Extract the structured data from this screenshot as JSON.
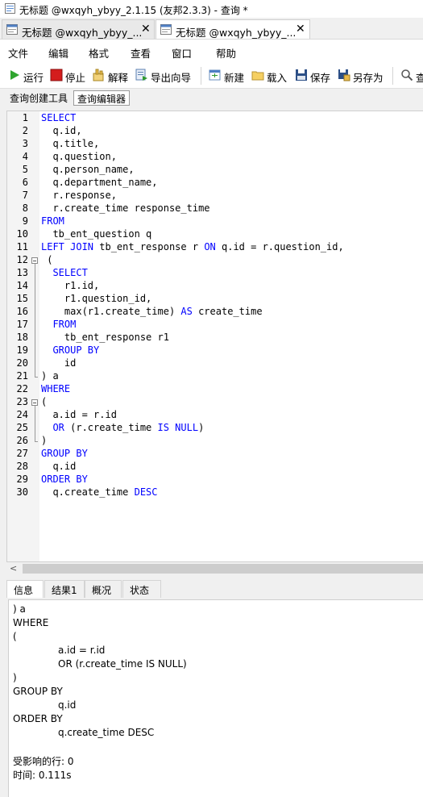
{
  "window": {
    "title": "无标题 @wxqyh_ybyy_2.1.15 (友邦2.3.3) - 查询 *"
  },
  "doc_tabs": [
    {
      "label": "无标题 @wxqyh_ybyy_...",
      "close": "✕"
    },
    {
      "label": "无标题 @wxqyh_ybyy_...",
      "close": "✕"
    }
  ],
  "menu": [
    "文件",
    "编辑",
    "格式",
    "查看",
    "窗口",
    "帮助"
  ],
  "toolbar": {
    "run": "运行",
    "stop": "停止",
    "explain": "解释",
    "export_wizard": "导出向导",
    "new": "新建",
    "load": "载入",
    "save": "保存",
    "save_as": "另存为",
    "find": "查"
  },
  "sub_tabs": [
    "查询创建工具",
    "查询编辑器"
  ],
  "editor": {
    "lines": [
      [
        [
          "k",
          "SELECT"
        ]
      ],
      [
        [
          "t",
          "  q.id,"
        ]
      ],
      [
        [
          "t",
          "  q.title,"
        ]
      ],
      [
        [
          "t",
          "  q.question,"
        ]
      ],
      [
        [
          "t",
          "  q.person_name,"
        ]
      ],
      [
        [
          "t",
          "  q.department_name,"
        ]
      ],
      [
        [
          "t",
          "  r.response,"
        ]
      ],
      [
        [
          "t",
          "  r.create_time response_time"
        ]
      ],
      [
        [
          "k",
          "FROM"
        ]
      ],
      [
        [
          "t",
          "  tb_ent_question q"
        ]
      ],
      [
        [
          "k",
          "LEFT JOIN"
        ],
        [
          "t",
          " tb_ent_response r "
        ],
        [
          "k",
          "ON"
        ],
        [
          "t",
          " q.id = r.question_id,"
        ]
      ],
      [
        [
          "t",
          " ("
        ]
      ],
      [
        [
          "t",
          "  "
        ],
        [
          "k",
          "SELECT"
        ]
      ],
      [
        [
          "t",
          "    r1.id,"
        ]
      ],
      [
        [
          "t",
          "    r1.question_id,"
        ]
      ],
      [
        [
          "t",
          "    max(r1.create_time) "
        ],
        [
          "k",
          "AS"
        ],
        [
          "t",
          " create_time"
        ]
      ],
      [
        [
          "t",
          "  "
        ],
        [
          "k",
          "FROM"
        ]
      ],
      [
        [
          "t",
          "    tb_ent_response r1"
        ]
      ],
      [
        [
          "t",
          "  "
        ],
        [
          "k",
          "GROUP BY"
        ]
      ],
      [
        [
          "t",
          "    id"
        ]
      ],
      [
        [
          "t",
          ") a"
        ]
      ],
      [
        [
          "k",
          "WHERE"
        ]
      ],
      [
        [
          "t",
          "("
        ]
      ],
      [
        [
          "t",
          "  a.id = r.id"
        ]
      ],
      [
        [
          "t",
          "  "
        ],
        [
          "k",
          "OR"
        ],
        [
          "t",
          " (r.create_time "
        ],
        [
          "k",
          "IS NULL"
        ],
        [
          "t",
          ")"
        ]
      ],
      [
        [
          "t",
          ")"
        ]
      ],
      [
        [
          "k",
          "GROUP BY"
        ]
      ],
      [
        [
          "t",
          "  q.id"
        ]
      ],
      [
        [
          "k",
          "ORDER BY"
        ]
      ],
      [
        [
          "t",
          "  q.create_time "
        ],
        [
          "k",
          "DESC"
        ]
      ]
    ]
  },
  "bottom_tabs": [
    "信息",
    "结果1",
    "概况",
    "状态"
  ],
  "output_lines": [
    ") a",
    "WHERE",
    "(",
    "\t\ta.id = r.id",
    "\t\tOR (r.create_time IS NULL)",
    ")",
    "GROUP BY",
    "\t\tq.id",
    "ORDER BY",
    "\t\tq.create_time DESC",
    "",
    "受影响的行: 0",
    "时间: 0.111s"
  ]
}
